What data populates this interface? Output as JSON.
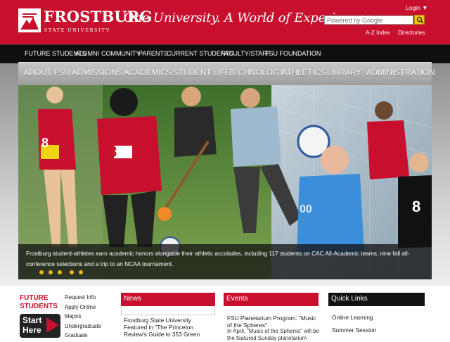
{
  "header": {
    "logo_name": "FROSTBURG",
    "logo_subtitle": "STATE UNIVERSITY",
    "tagline": "One University. A World of Experiences.",
    "login_label": "Login ▼",
    "search_placeholder": "Powered by Google",
    "links": [
      "A-Z Index",
      "Directories"
    ],
    "brand_color": "#c8102e"
  },
  "top_nav": [
    "FUTURE STUDENTS",
    "ALUMNI",
    "COMMUNITY",
    "PARENTS",
    "CURRENT STUDENTS",
    "FACULTY/STAFF",
    "FSU FOUNDATION"
  ],
  "main_nav": [
    "ABOUT FSU",
    "ADMISSIONS",
    "ACADEMICS",
    "STUDENT LIFE",
    "TECHNOLOGY",
    "ATHLETICS",
    "LIBRARY",
    "ADMINISTRATION"
  ],
  "hero": {
    "caption": "Frostburg student-athletes earn academic honors alongside their athletic accolades, including 117 students on CAC All-Academic teams, nine fall all-conference selections and a trip to an NCAA tournament.",
    "slide_count": 5,
    "jerseys": [
      "8",
      "8",
      "00",
      "8"
    ]
  },
  "future_students": {
    "title_line1": "FUTURE",
    "title_line2": "STUDENTS",
    "start_line1": "Start",
    "start_line2": "Here",
    "links": [
      "Request Info",
      "Apply Online",
      "Majors",
      "Undergraduate",
      "Graduate"
    ]
  },
  "news": {
    "title": "News",
    "items": [
      "FSU Planetarium Program:"
    ],
    "headline": "Frostburg State University Featured in \"The Princeton Review's Guide to 353 Green"
  },
  "events": {
    "title": "Events",
    "headline": "FSU Planetarium Program: \"Music of the Spheres\"",
    "body": "In April, \"Music of the Spheres\" will be the featured Sunday planetarium"
  },
  "quick_links": {
    "title": "Quick Links",
    "items": [
      "Online Learning",
      "Summer Session"
    ]
  }
}
